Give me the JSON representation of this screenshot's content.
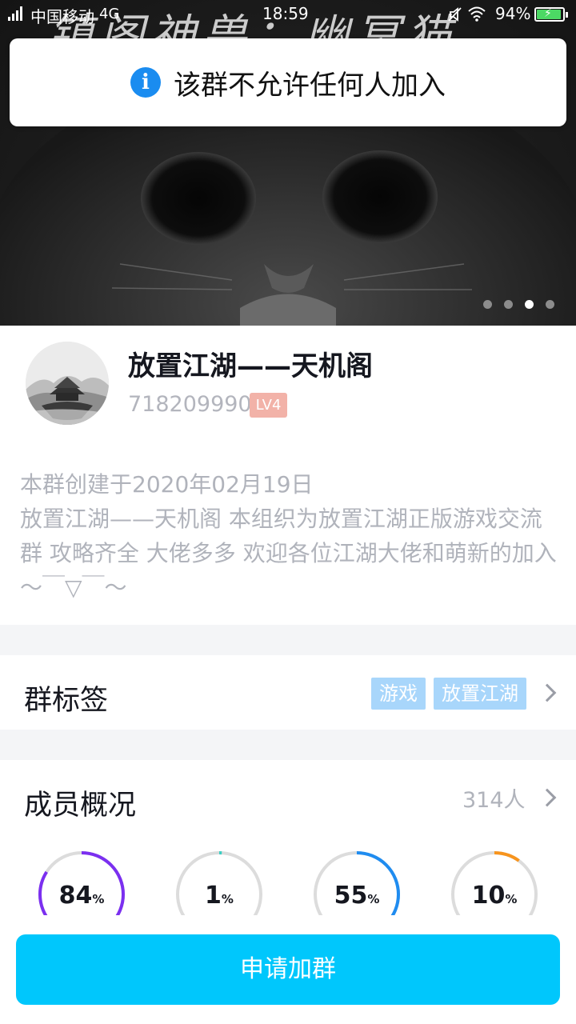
{
  "status_bar": {
    "carrier": "中国移动",
    "network": "4G",
    "time": "18:59",
    "battery_percent": "94%"
  },
  "banner": {
    "watermark_text": "镇阁神兽：幽冥猫",
    "page_count": 4,
    "active_page": 3
  },
  "toast": {
    "icon": "info-icon",
    "message": "该群不允许任何人加入"
  },
  "group": {
    "name": "放置江湖——天机阁",
    "id": "718209990",
    "level": "LV4",
    "description": "本群创建于2020年02月19日\n放置江湖——天机阁  本组织为放置江湖正版游戏交流群 攻略齐全 大佬多多 欢迎各位江湖大佬和萌新的加入～￣▽￣～"
  },
  "tags_section": {
    "title": "群标签",
    "tags": [
      "游戏",
      "放置江湖"
    ]
  },
  "members_section": {
    "title": "成员概况",
    "count": "314人",
    "stats": [
      {
        "value": "84",
        "unit": "%",
        "fraction": 0.84,
        "color": "#7b2ff0"
      },
      {
        "value": "1",
        "unit": "%",
        "fraction": 0.01,
        "color": "#3ccfc4"
      },
      {
        "value": "55",
        "unit": "%",
        "fraction": 0.55,
        "color": "#1f8cf0"
      },
      {
        "value": "10",
        "unit": "%",
        "fraction": 0.1,
        "color": "#f7941d"
      }
    ]
  },
  "apply_button": {
    "label": "申请加群"
  },
  "colors": {
    "accent": "#00c7fc",
    "tag_bg": "#a8d6fb",
    "level_badge": "#f2b2a8"
  }
}
